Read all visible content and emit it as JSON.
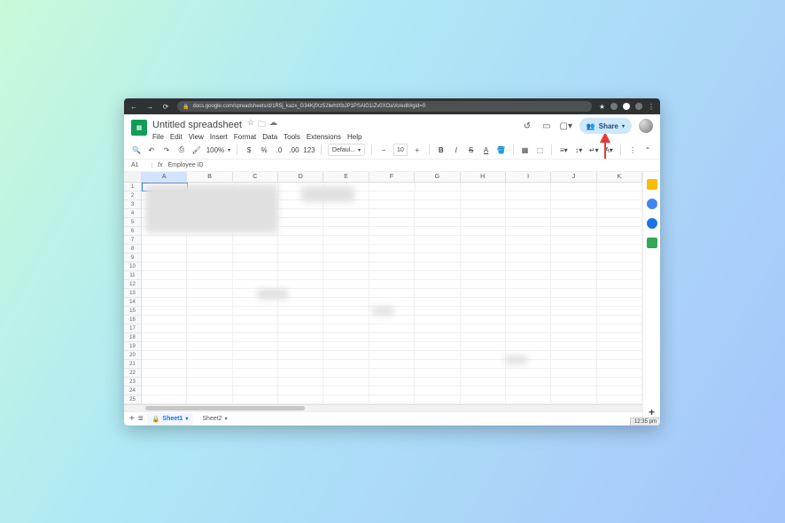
{
  "browser": {
    "url": "docs.google.com/spreadsheets/d/1R5j_kazx_G34KjfXz52lwhtXbJP1PSAlG1iZv0XOaVo/edit#gid=0"
  },
  "document": {
    "title": "Untitled spreadsheet",
    "menu": [
      "File",
      "Edit",
      "View",
      "Insert",
      "Format",
      "Data",
      "Tools",
      "Extensions",
      "Help"
    ],
    "share_label": "Share"
  },
  "toolbar": {
    "zoom": "100%",
    "font": "Defaul...",
    "font_size": "10"
  },
  "formula": {
    "cell": "A1",
    "value": "Employee ID"
  },
  "grid": {
    "columns": [
      "A",
      "B",
      "C",
      "D",
      "E",
      "F",
      "G",
      "H",
      "I",
      "J",
      "K"
    ],
    "row_count": 25
  },
  "tabs": {
    "add": "+",
    "list": "≡",
    "sheets": [
      {
        "name": "Sheet1",
        "locked": true,
        "active": true
      },
      {
        "name": "Sheet2",
        "locked": false,
        "active": false
      }
    ]
  },
  "status": {
    "time": "12:35 pm"
  }
}
